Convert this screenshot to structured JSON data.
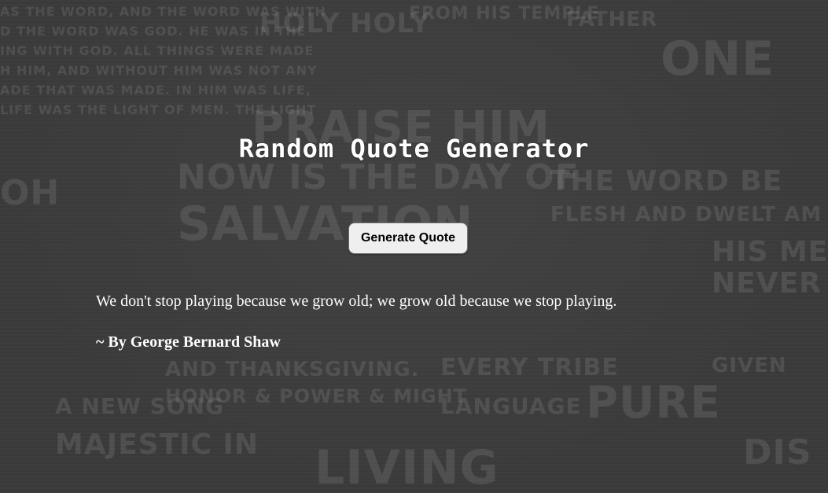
{
  "page": {
    "title": "Random Quote Generator",
    "button_label": "Generate Quote"
  },
  "quote": {
    "text": "We don't stop playing because we grow old; we grow old because we stop playing.",
    "author": "~ By George Bernard Shaw"
  },
  "colors": {
    "background": "#3c3c3c",
    "text": "#ffffff",
    "button_bg": "#efefef"
  }
}
